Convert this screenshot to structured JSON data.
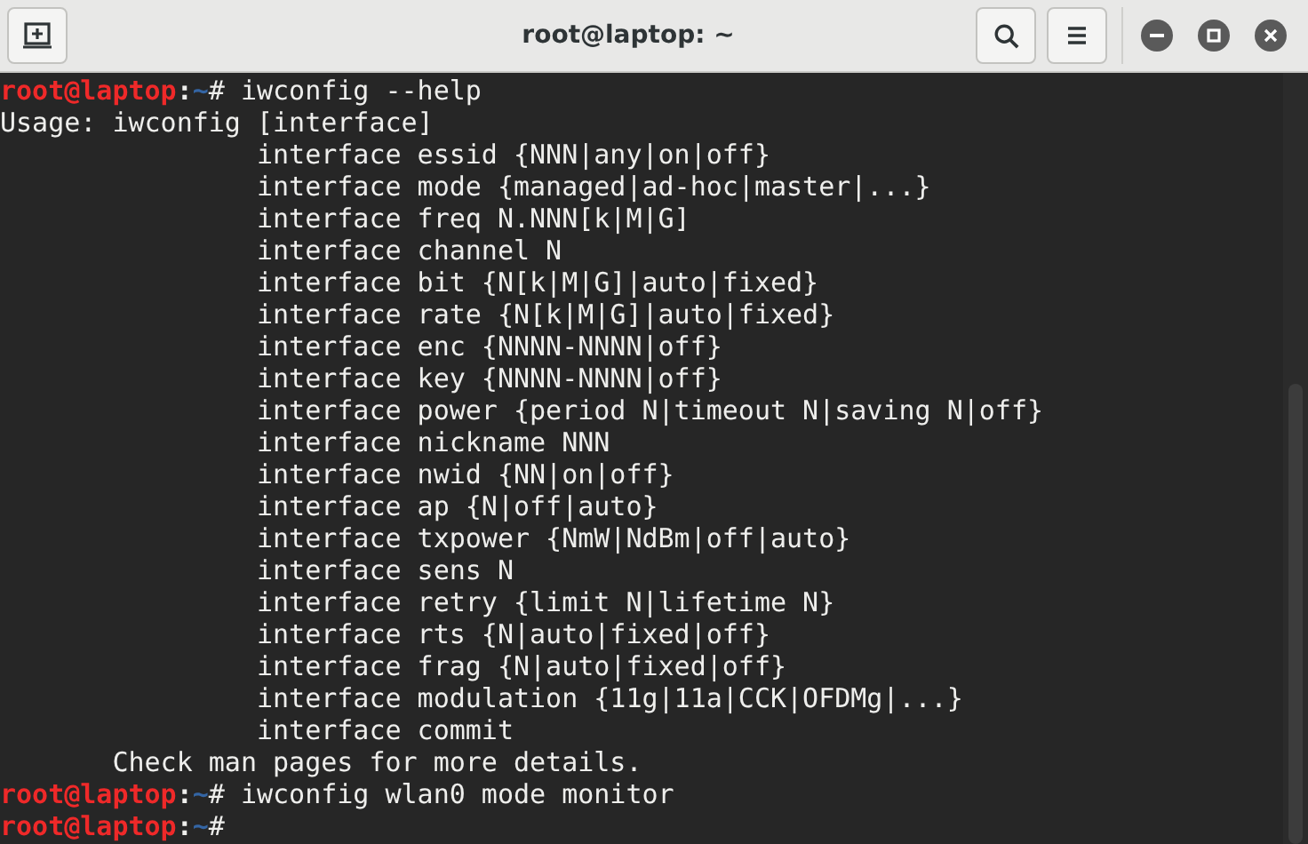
{
  "window": {
    "title": "root@laptop: ~"
  },
  "terminal": {
    "lines": [
      {
        "kind": "prompt",
        "user_host": "root@laptop",
        "separator": ":",
        "path": "~",
        "symbol": "#",
        "command": " iwconfig --help"
      },
      {
        "kind": "output",
        "text": "Usage: iwconfig [interface]"
      },
      {
        "kind": "output",
        "text": "                interface essid {NNN|any|on|off}"
      },
      {
        "kind": "output",
        "text": "                interface mode {managed|ad-hoc|master|...}"
      },
      {
        "kind": "output",
        "text": "                interface freq N.NNN[k|M|G]"
      },
      {
        "kind": "output",
        "text": "                interface channel N"
      },
      {
        "kind": "output",
        "text": "                interface bit {N[k|M|G]|auto|fixed}"
      },
      {
        "kind": "output",
        "text": "                interface rate {N[k|M|G]|auto|fixed}"
      },
      {
        "kind": "output",
        "text": "                interface enc {NNNN-NNNN|off}"
      },
      {
        "kind": "output",
        "text": "                interface key {NNNN-NNNN|off}"
      },
      {
        "kind": "output",
        "text": "                interface power {period N|timeout N|saving N|off}"
      },
      {
        "kind": "output",
        "text": "                interface nickname NNN"
      },
      {
        "kind": "output",
        "text": "                interface nwid {NN|on|off}"
      },
      {
        "kind": "output",
        "text": "                interface ap {N|off|auto}"
      },
      {
        "kind": "output",
        "text": "                interface txpower {NmW|NdBm|off|auto}"
      },
      {
        "kind": "output",
        "text": "                interface sens N"
      },
      {
        "kind": "output",
        "text": "                interface retry {limit N|lifetime N}"
      },
      {
        "kind": "output",
        "text": "                interface rts {N|auto|fixed|off}"
      },
      {
        "kind": "output",
        "text": "                interface frag {N|auto|fixed|off}"
      },
      {
        "kind": "output",
        "text": "                interface modulation {11g|11a|CCK|OFDMg|...}"
      },
      {
        "kind": "output",
        "text": "                interface commit"
      },
      {
        "kind": "output",
        "text": "       Check man pages for more details."
      },
      {
        "kind": "prompt",
        "user_host": "root@laptop",
        "separator": ":",
        "path": "~",
        "symbol": "#",
        "command": " iwconfig wlan0 mode monitor"
      },
      {
        "kind": "prompt",
        "user_host": "root@laptop",
        "separator": ":",
        "path": "~",
        "symbol": "#"
      }
    ]
  }
}
